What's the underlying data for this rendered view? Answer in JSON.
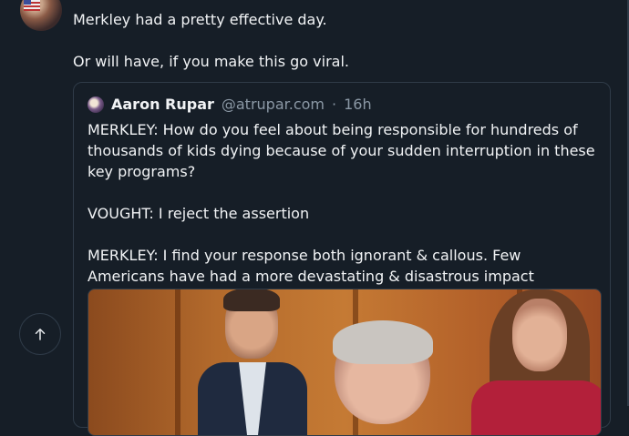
{
  "post": {
    "text_lines": [
      "Merkley had a pretty effective day.",
      "Or will have, if you make this go viral."
    ]
  },
  "quote": {
    "author_name": "Aaron Rupar",
    "handle": "@atrupar.com",
    "separator": "·",
    "time": "16h",
    "paragraphs": [
      "MERKLEY: How do you feel about being responsible for hundreds of thousands of kids dying because of your sudden interruption in these key programs?",
      "VOUGHT: I reject the assertion",
      "MERKLEY: I find your response both ignorant & callous. Few Americans have had a more devastating & disastrous impact"
    ]
  },
  "icons": {
    "scroll_top": "arrow-up-icon",
    "avatar": "user-avatar",
    "quote_avatar": "quoted-user-avatar"
  },
  "colors": {
    "background": "#161e27",
    "text": "#f1f3f5",
    "muted": "#8b98a5",
    "border": "#2f3b48"
  }
}
